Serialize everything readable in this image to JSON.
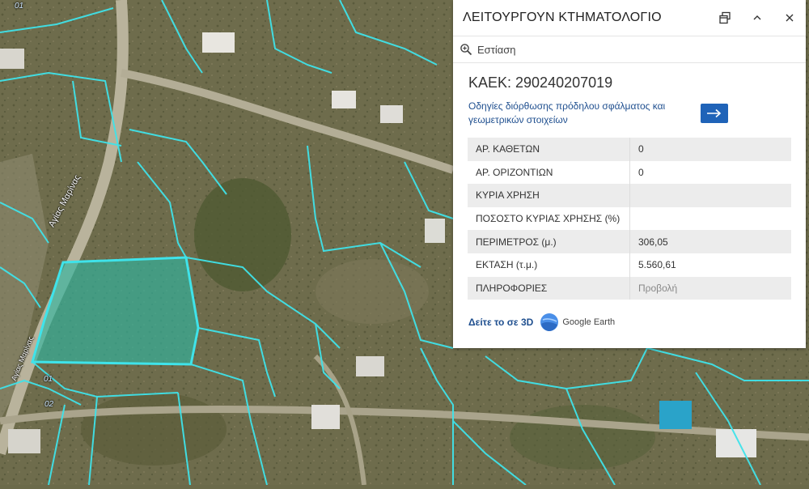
{
  "map": {
    "street_label_main": "Αγίας Μαρίνας",
    "street_label_lower": "Αγίας Μαρίνας",
    "section_labels": [
      "01",
      "01",
      "02"
    ]
  },
  "panel": {
    "title": "ΛΕΙΤΟΥΡΓΟΥΝ ΚΤΗΜΑΤΟΛΟΓΙΟ",
    "zoom_label": "Εστίαση",
    "kaek": "ΚΑΕΚ: 290240207019",
    "guide_text": "Οδηγίες διόρθωσης πρόδηλου σφάλματος και γεωμετρικών στοιχείων",
    "rows": [
      {
        "label": "ΑΡ. ΚΑΘΕΤΩΝ",
        "value": "0"
      },
      {
        "label": "ΑΡ. ΟΡΙΖΟΝΤΙΩΝ",
        "value": "0"
      },
      {
        "label": "ΚΥΡΙΑ ΧΡΗΣΗ",
        "value": ""
      },
      {
        "label": "ΠΟΣΟΣΤΟ ΚΥΡΙΑΣ ΧΡΗΣΗΣ (%)",
        "value": ""
      },
      {
        "label": "ΠΕΡΙΜΕΤΡΟΣ (μ.)",
        "value": "306,05"
      },
      {
        "label": "ΕΚΤΑΣΗ (τ.μ.)",
        "value": "5.560,61"
      },
      {
        "label": "ΠΛΗΡΟΦΟΡΙΕΣ",
        "value": "Προβολή"
      }
    ],
    "see_3d": "Δείτε το σε 3D",
    "google_earth": "Google Earth"
  },
  "colors": {
    "parcel_outline": "#3fe3ea",
    "selected_fill": "#2fb6a0",
    "accent_button": "#1f63b8",
    "link_text": "#1f4f8f"
  },
  "icons": [
    "restore-window-icon",
    "chevron-up-icon",
    "close-icon",
    "zoom-in-icon",
    "arrow-right-icon",
    "google-earth-logo"
  ]
}
